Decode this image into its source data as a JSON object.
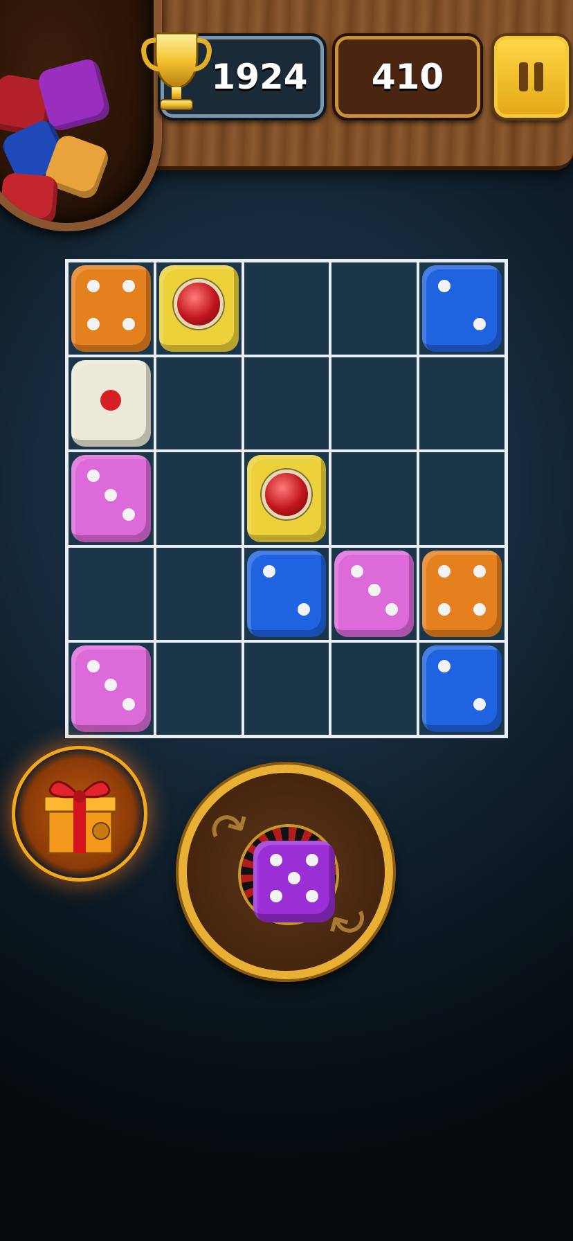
{
  "hud": {
    "best_score": "1924",
    "current_score": "410",
    "pause_icon": "pause-icon",
    "trophy_icon": "trophy-icon"
  },
  "board": {
    "rows": 5,
    "cols": 5,
    "cells": [
      [
        {
          "color": "#e5801f",
          "pips": 4
        },
        {
          "color": "#ecd13a",
          "gem": true
        },
        null,
        null,
        {
          "color": "#1f63e0",
          "pips": 2
        }
      ],
      [
        {
          "color": "#ede9d8",
          "pips": 1,
          "red": true
        },
        null,
        null,
        null,
        null
      ],
      [
        {
          "color": "#dc6ad9",
          "pips": 3
        },
        null,
        {
          "color": "#ecd13a",
          "gem": true
        },
        null,
        null
      ],
      [
        null,
        null,
        {
          "color": "#1f63e0",
          "pips": 2
        },
        {
          "color": "#dc6ad9",
          "pips": 3
        },
        {
          "color": "#e5801f",
          "pips": 4
        }
      ],
      [
        {
          "color": "#dc6ad9",
          "pips": 3
        },
        null,
        null,
        null,
        {
          "color": "#1f63e0",
          "pips": 2
        }
      ]
    ]
  },
  "next_die": {
    "color": "#9a2fd6",
    "pips": 5
  },
  "controls": {
    "gift_icon": "gift-icon",
    "rotate_icon": "rotate-icon"
  }
}
